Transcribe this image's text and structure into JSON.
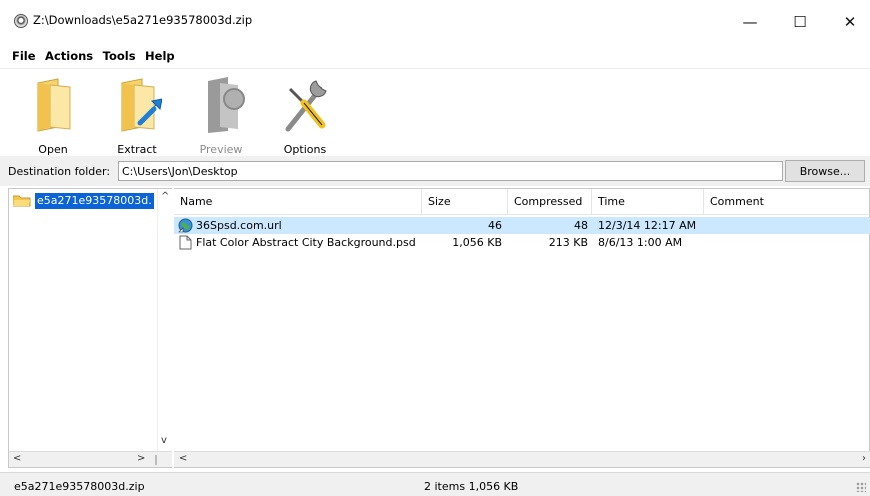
{
  "window": {
    "title": "Z:\\Downloads\\e5a271e93578003d.zip",
    "minimize_glyph": "—",
    "maximize_glyph": "☐",
    "close_glyph": "✕"
  },
  "menu": [
    "File",
    "Actions",
    "Tools",
    "Help"
  ],
  "toolbar": {
    "open": "Open",
    "extract": "Extract",
    "preview": "Preview",
    "options": "Options"
  },
  "destination": {
    "label": "Destination folder:",
    "value": "C:\\Users\\Jon\\Desktop",
    "browse": "Browse..."
  },
  "tree": {
    "item": "e5a271e93578003d.",
    "scroll_up": "^",
    "scroll_down": "v",
    "scroll_left": "<",
    "scroll_right": ">"
  },
  "list": {
    "columns": [
      "Name",
      "Size",
      "Compressed",
      "Time",
      "Comment"
    ],
    "rows": [
      {
        "name": "36Spsd.com.url",
        "size": "46",
        "compressed": "48",
        "time": "12/3/14 12:17 AM",
        "comment": "",
        "icon": "internet-shortcut-icon"
      },
      {
        "name": "Flat Color Abstract City Background.psd",
        "size": "1,056 KB",
        "compressed": "213 KB",
        "time": "8/6/13 1:00 AM",
        "comment": "",
        "icon": "file-icon"
      }
    ],
    "scroll_left": "<",
    "scroll_right": "›"
  },
  "status": {
    "archive": "e5a271e93578003d.zip",
    "summary": "2 items  1,056 KB"
  },
  "colors": {
    "selection": "#0a64d8",
    "row_highlight": "#cce8ff",
    "panel": "#f0f0f0"
  }
}
